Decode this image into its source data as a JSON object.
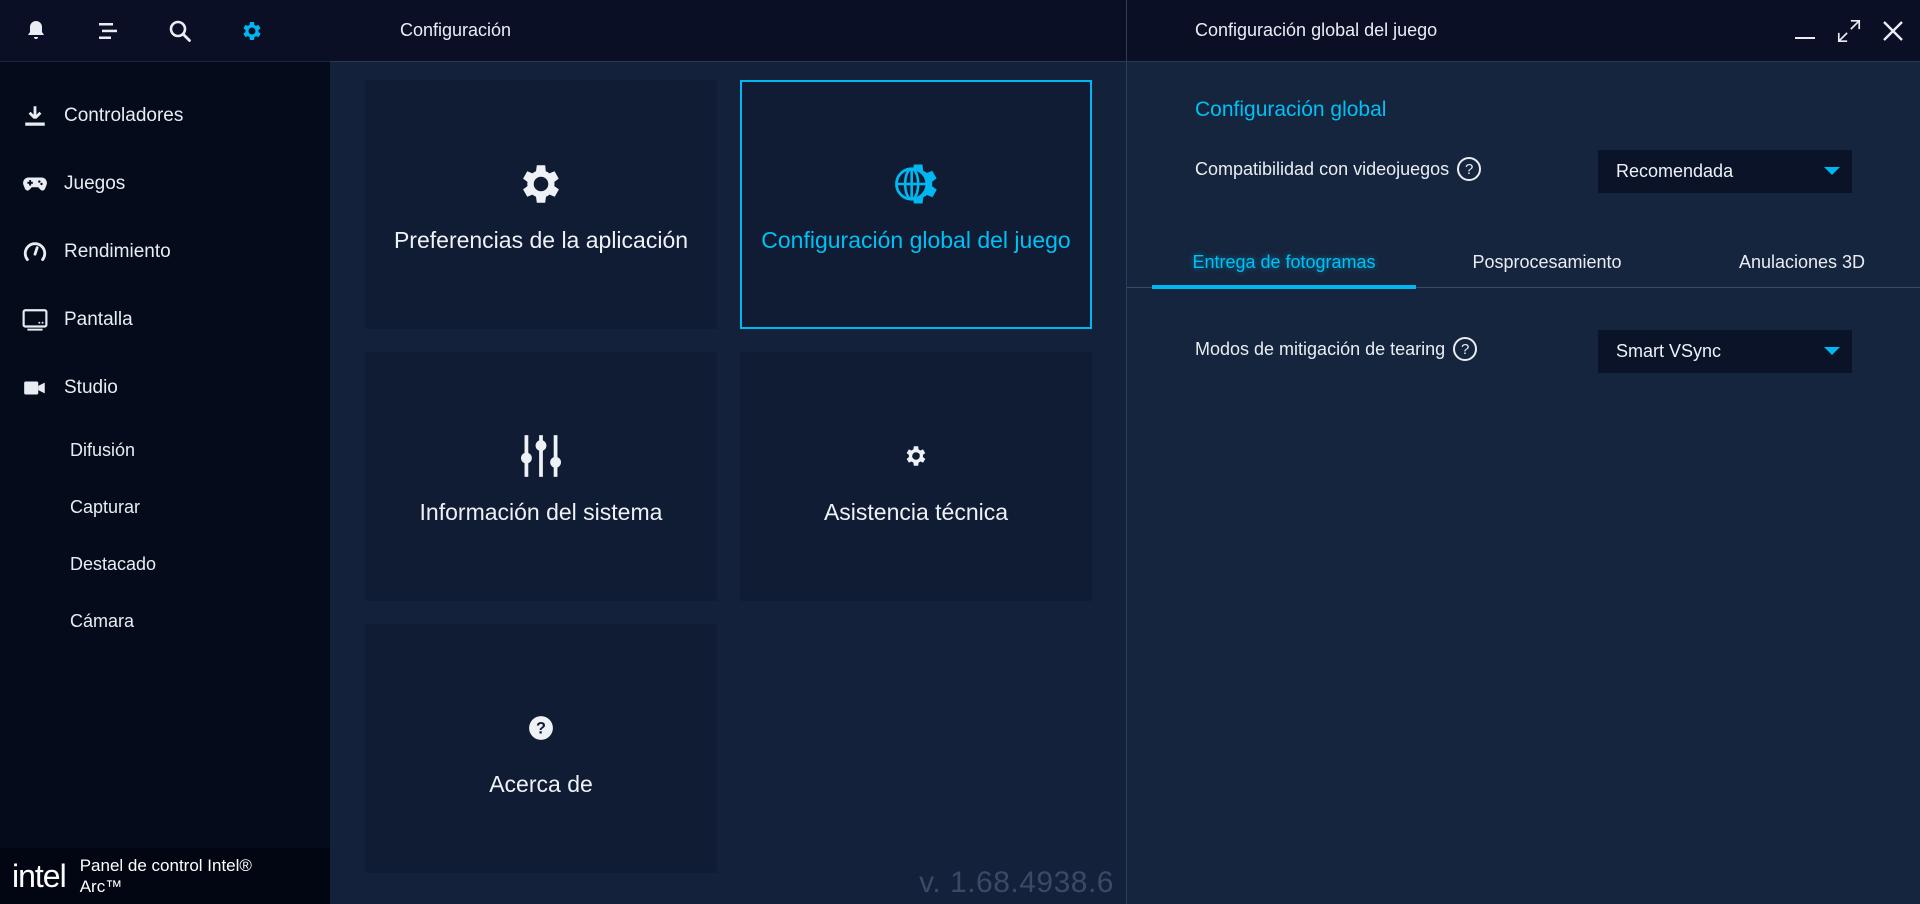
{
  "sidebar": {
    "top_icons": [
      "bell-icon",
      "list-icon",
      "search-icon",
      "gear-icon"
    ],
    "nav": [
      {
        "label": "Controladores",
        "icon": "download-icon"
      },
      {
        "label": "Juegos",
        "icon": "gamepad-icon"
      },
      {
        "label": "Rendimiento",
        "icon": "gauge-icon"
      },
      {
        "label": "Pantalla",
        "icon": "monitor-icon"
      },
      {
        "label": "Studio",
        "icon": "camera-icon"
      }
    ],
    "sub_items": [
      "Difusión",
      "Capturar",
      "Destacado",
      "Cámara"
    ],
    "brand": {
      "logo": "intel",
      "text": "Panel de control Intel® Arc™"
    }
  },
  "middle": {
    "title": "Configuración",
    "tiles": [
      {
        "label": "Preferencias de la aplicación",
        "icon": "gear-icon"
      },
      {
        "label": "Configuración global del juego",
        "icon": "globe-gear-icon"
      },
      {
        "label": "Información del sistema",
        "icon": "sliders-icon"
      },
      {
        "label": "Asistencia técnica",
        "icon": "small-gear-icon"
      },
      {
        "label": "Acerca de",
        "icon": "question-icon"
      }
    ],
    "version": "v. 1.68.4938.6"
  },
  "right": {
    "title": "Configuración global del juego",
    "section_title": "Configuración global",
    "compat_label": "Compatibilidad con videojuegos",
    "compat_value": "Recomendada",
    "tabs": [
      "Entrega de fotogramas",
      "Posprocesamiento",
      "Anulaciones 3D"
    ],
    "tearing_label": "Modos de mitigación de tearing",
    "tearing_value": "Smart VSync",
    "help_symbol": "?"
  },
  "colors": {
    "accent": "#00b7f1",
    "sidebar_bg": "#040b1a",
    "panel_bg": "#13223a"
  }
}
